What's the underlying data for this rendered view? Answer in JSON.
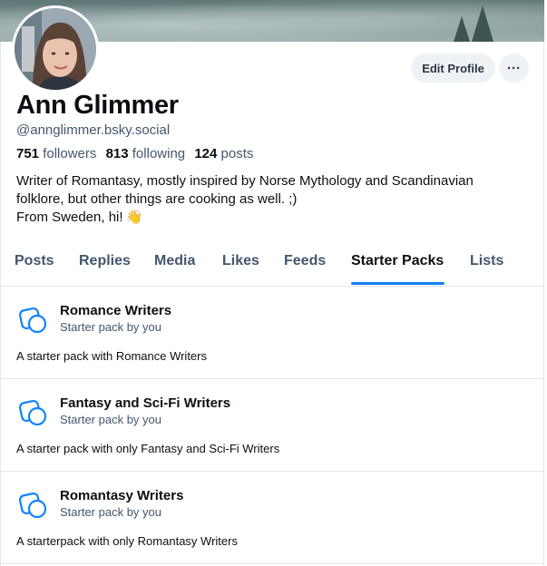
{
  "profile": {
    "name": "Ann Glimmer",
    "handle": "@annglimmer.bsky.social",
    "followers_count": "751",
    "followers_label": "followers",
    "following_count": "813",
    "following_label": "following",
    "posts_count": "124",
    "posts_label": "posts",
    "bio_line1": "Writer of Romantasy, mostly inspired by Norse Mythology and Scandinavian",
    "bio_line2": "folklore, but other things are cooking as well. ;)",
    "bio_line3": "From Sweden, hi!",
    "bio_emoji": "👋"
  },
  "actions": {
    "edit_label": "Edit Profile",
    "more_label": "···"
  },
  "tabs": [
    {
      "label": "Posts"
    },
    {
      "label": "Replies"
    },
    {
      "label": "Media"
    },
    {
      "label": "Likes"
    },
    {
      "label": "Feeds"
    },
    {
      "label": "Starter Packs"
    },
    {
      "label": "Lists"
    }
  ],
  "active_tab": "Starter Packs",
  "starter_packs": [
    {
      "title": "Romance Writers",
      "subtitle": "Starter pack by you",
      "description": "A starter pack with Romance Writers"
    },
    {
      "title": "Fantasy and Sci-Fi Writers",
      "subtitle": "Starter pack by you",
      "description": "A starter pack with only Fantasy and Sci-Fi Writers"
    },
    {
      "title": "Romantasy Writers",
      "subtitle": "Starter pack by you",
      "description": "A starterpack with only Romantasy Writers"
    }
  ],
  "colors": {
    "accent": "#1083fe",
    "text_primary": "#0b0f14",
    "text_secondary": "#42576c",
    "button_bg": "#eff2f5",
    "divider": "#e3e7eb"
  },
  "icons": {
    "starter_pack": "starter-pack-icon",
    "more": "ellipsis-icon"
  }
}
